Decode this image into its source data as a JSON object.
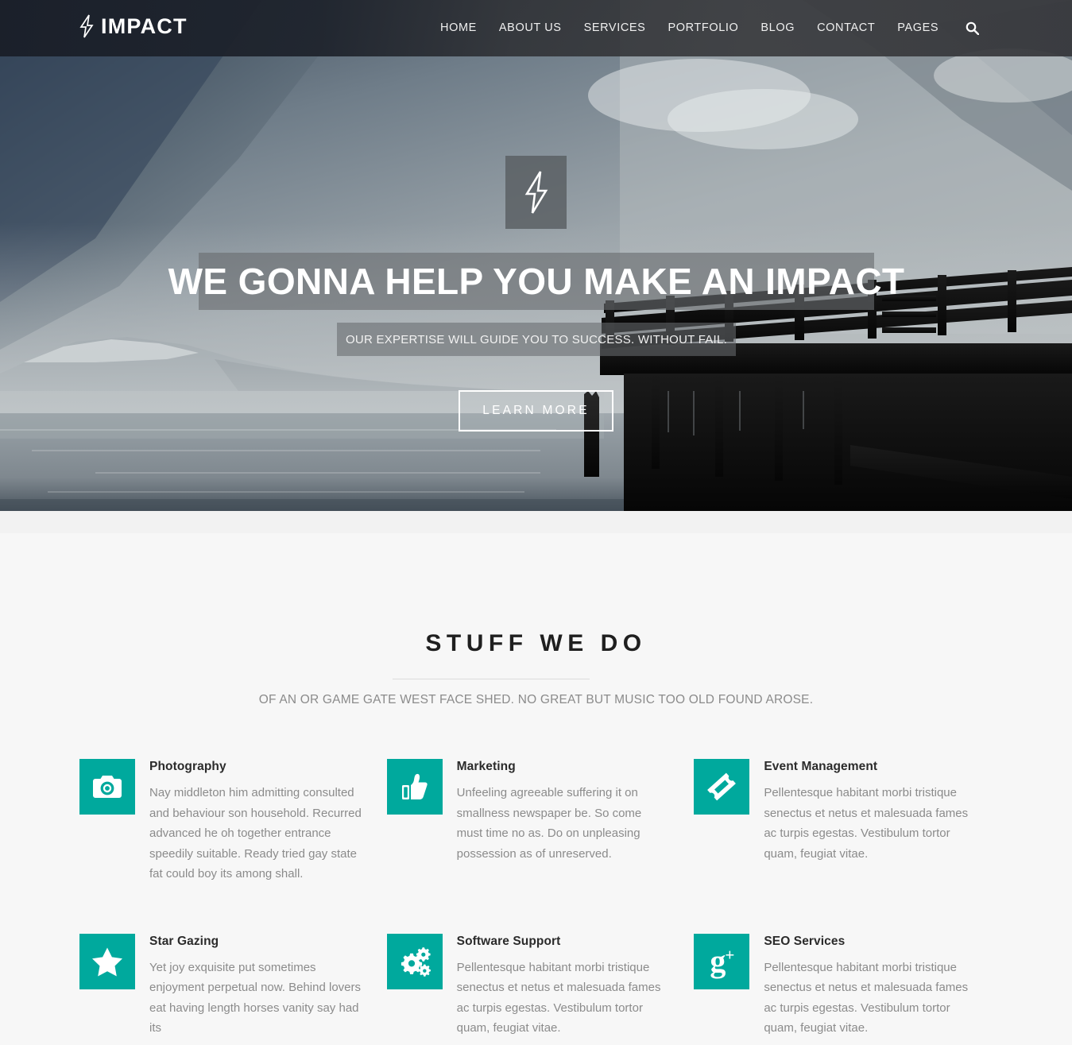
{
  "header": {
    "brand": {
      "name": "IMPACT",
      "icon": "lightning-bolt-icon"
    },
    "nav_items": [
      {
        "label": "HOME"
      },
      {
        "label": "ABOUT US"
      },
      {
        "label": "SERVICES"
      },
      {
        "label": "PORTFOLIO"
      },
      {
        "label": "BLOG"
      },
      {
        "label": "CONTACT"
      },
      {
        "label": "PAGES"
      }
    ],
    "search_icon": "search-icon"
  },
  "hero": {
    "badge_icon": "lightning-bolt-icon",
    "title": "WE GONNA HELP YOU MAKE AN IMPACT",
    "subtitle": "OUR EXPERTISE WILL GUIDE YOU TO SUCCESS. WITHOUT FAIL.",
    "cta_label": "LEARN MORE"
  },
  "services": {
    "title": "STUFF WE DO",
    "subtitle": "OF AN OR GAME GATE WEST FACE SHED. NO GREAT BUT MUSIC TOO OLD FOUND AROSE.",
    "accent_color": "#00a99d",
    "cards": [
      {
        "icon": "camera-icon",
        "title": "Photography",
        "text": "Nay middleton him admitting consulted and behaviour son household. Recurred advanced he oh together entrance speedily suitable. Ready tried gay state fat could boy its among shall."
      },
      {
        "icon": "thumbs-up-icon",
        "title": "Marketing",
        "text": "Unfeeling agreeable suffering it on smallness newspaper be. So come must time no as. Do on unpleasing possession as of unreserved."
      },
      {
        "icon": "ticket-icon",
        "title": "Event Management",
        "text": "Pellentesque habitant morbi tristique senectus et netus et malesuada fames ac turpis egestas. Vestibulum tortor quam, feugiat vitae."
      },
      {
        "icon": "star-icon",
        "title": "Star Gazing",
        "text": "Yet joy exquisite put sometimes enjoyment perpetual now. Behind lovers eat having length horses vanity say had its"
      },
      {
        "icon": "gears-icon",
        "title": "Software Support",
        "text": "Pellentesque habitant morbi tristique senectus et netus et malesuada fames ac turpis egestas. Vestibulum tortor quam, feugiat vitae."
      },
      {
        "icon": "google-plus-icon",
        "title": "SEO Services",
        "text": "Pellentesque habitant morbi tristique senectus et netus et malesuada fames ac turpis egestas. Vestibulum tortor quam, feugiat vitae."
      }
    ]
  }
}
